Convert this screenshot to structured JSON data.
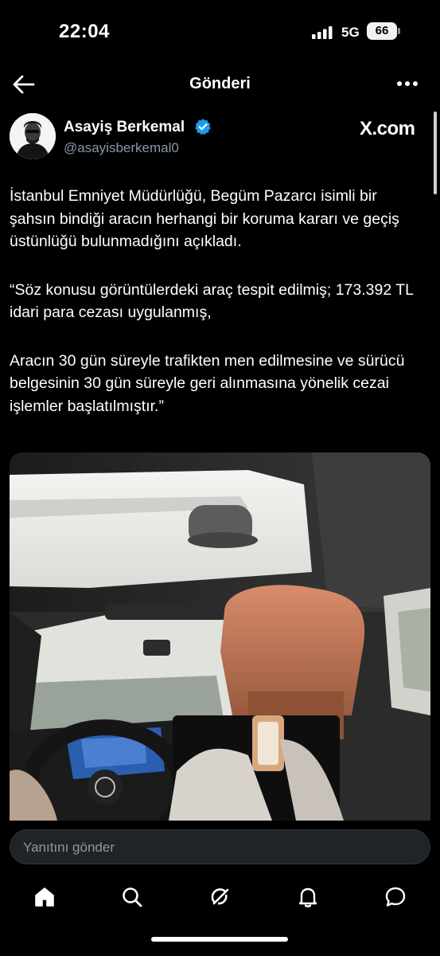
{
  "status_bar": {
    "time": "22:04",
    "network": "5G",
    "battery": "66"
  },
  "header": {
    "title": "Gönderi"
  },
  "author": {
    "display_name": "Asayiş Berkemal",
    "handle": "@asayisberkemal0",
    "verified": true
  },
  "brand": "X.com",
  "post": {
    "paragraphs": [
      "İstanbul Emniyet Müdürlüğü, Begüm Pazarcı isimli bir şahsın bindiği aracın herhangi bir koruma kararı ve geçiş üstünlüğü bulunmadığını açıkladı.",
      "“Söz konusu görüntülerdeki araç tespit edilmiş; 173.392 TL idari para cezası uygulanmış,",
      "Aracın 30 gün süreyle trafikten men edilmesine ve sürücü belgesinin 30 gün süreyle geri alınmasına yönelik cezai işlemler başlatılmıştır.”"
    ]
  },
  "reply": {
    "placeholder": "Yanıtını gönder"
  },
  "tabs": [
    {
      "name": "home",
      "icon": "home-icon",
      "active": true
    },
    {
      "name": "search",
      "icon": "search-icon"
    },
    {
      "name": "grok",
      "icon": "grok-icon"
    },
    {
      "name": "notifications",
      "icon": "bell-icon"
    },
    {
      "name": "messages",
      "icon": "message-icon"
    }
  ],
  "colors": {
    "background": "#000000",
    "text": "#ffffff",
    "secondary_text": "#8b98a5",
    "verified": "#1d9bf0",
    "reply_bg": "#202327"
  }
}
